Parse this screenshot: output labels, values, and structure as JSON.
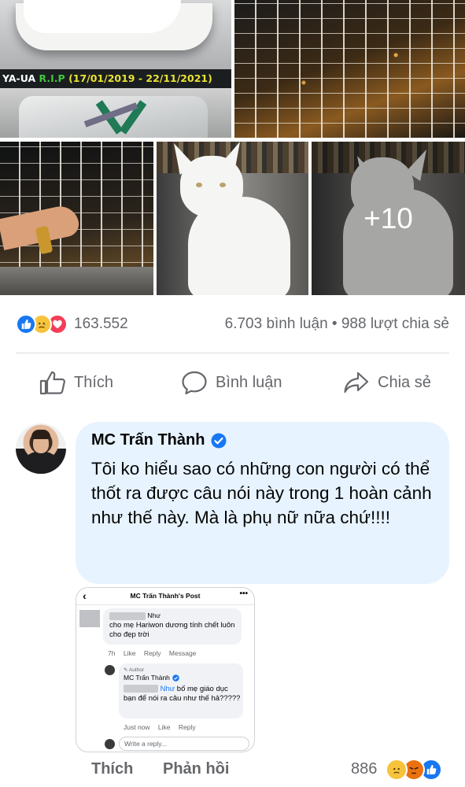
{
  "photos": {
    "memorial": {
      "name": "YA-UA",
      "rip": "R.I.P",
      "dates": "(17/01/2019 - 22/11/2021)"
    },
    "more_overlay": "+10"
  },
  "reactions": {
    "icons": [
      "like-icon",
      "sad-icon",
      "love-icon"
    ],
    "count": "163.552"
  },
  "stats": {
    "comments": "6.703 bình luận",
    "separator": "•",
    "shares": "988 lượt chia sẻ"
  },
  "actions": {
    "like": "Thích",
    "comment": "Bình luận",
    "share": "Chia sẻ"
  },
  "comment": {
    "author": "MC Trấn Thành",
    "text": "Tôi ko hiểu sao có những con người có thể thốt ra được câu nói này trong 1 hoàn cảnh như thế này. Mà là phụ nữ nữa chứ!!!!",
    "footer": {
      "like": "Thích",
      "reply": "Phản hồi",
      "reaction_count": "886"
    }
  },
  "embedded_post": {
    "back_glyph": "‹",
    "title": "MC Trấn Thành's Post",
    "menu_glyph": "•••",
    "first_comment": {
      "name_visible": "Như",
      "text": "cho mẹ Hariwon dương tính chết luôn cho đẹp trời",
      "time": "7h",
      "like": "Like",
      "reply": "Reply",
      "message": "Message"
    },
    "reply": {
      "tag": "Author",
      "author": "MC Trấn Thành",
      "mention": "Như",
      "text": " bố mẹ giáo dục bạn để nói ra câu như thế hả?????",
      "time": "Just now",
      "like": "Like",
      "reply": "Reply"
    },
    "input_placeholder": "Write a reply..."
  },
  "colors": {
    "facebook_blue": "#1877f2",
    "bubble_bg": "#e7f3ff",
    "muted_text": "#65676b",
    "rip_green": "#3fc73c",
    "date_yellow": "#e9e233"
  }
}
